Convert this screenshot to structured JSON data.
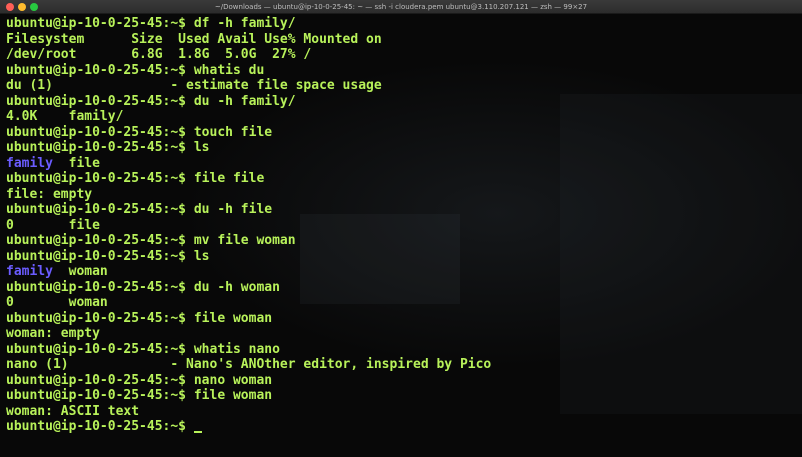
{
  "window": {
    "title": "~/Downloads — ubuntu@ip-10-0-25-45: ~ — ssh -i cloudera.pem ubuntu@3.110.207.121 — zsh — 99×27"
  },
  "colors": {
    "text": "#b8f25a",
    "directory": "#6b5cff",
    "background": "#080808"
  },
  "terminal": {
    "prompt": "ubuntu@ip-10-0-25-45:~$ ",
    "lines": [
      {
        "type": "command",
        "text": "df -h family/"
      },
      {
        "type": "output",
        "text": "Filesystem      Size  Used Avail Use% Mounted on"
      },
      {
        "type": "output",
        "text": "/dev/root       6.8G  1.8G  5.0G  27% /"
      },
      {
        "type": "command",
        "text": "whatis du"
      },
      {
        "type": "output",
        "text": "du (1)               - estimate file space usage"
      },
      {
        "type": "command",
        "text": "du -h family/"
      },
      {
        "type": "output",
        "text": "4.0K    family/"
      },
      {
        "type": "command",
        "text": "touch file"
      },
      {
        "type": "command",
        "text": "ls"
      },
      {
        "type": "ls",
        "dir": "family",
        "rest": "  file"
      },
      {
        "type": "command",
        "text": "file file"
      },
      {
        "type": "output",
        "text": "file: empty"
      },
      {
        "type": "command",
        "text": "du -h file"
      },
      {
        "type": "output",
        "text": "0       file"
      },
      {
        "type": "command",
        "text": "mv file woman"
      },
      {
        "type": "command",
        "text": "ls"
      },
      {
        "type": "ls",
        "dir": "family",
        "rest": "  woman"
      },
      {
        "type": "command",
        "text": "du -h woman"
      },
      {
        "type": "output",
        "text": "0       woman"
      },
      {
        "type": "command",
        "text": "file woman"
      },
      {
        "type": "output",
        "text": "woman: empty"
      },
      {
        "type": "command",
        "text": "whatis nano"
      },
      {
        "type": "output",
        "text": "nano (1)             - Nano's ANOther editor, inspired by Pico"
      },
      {
        "type": "command",
        "text": "nano woman"
      },
      {
        "type": "command",
        "text": "file woman"
      },
      {
        "type": "output",
        "text": "woman: ASCII text"
      },
      {
        "type": "current",
        "text": ""
      }
    ]
  }
}
